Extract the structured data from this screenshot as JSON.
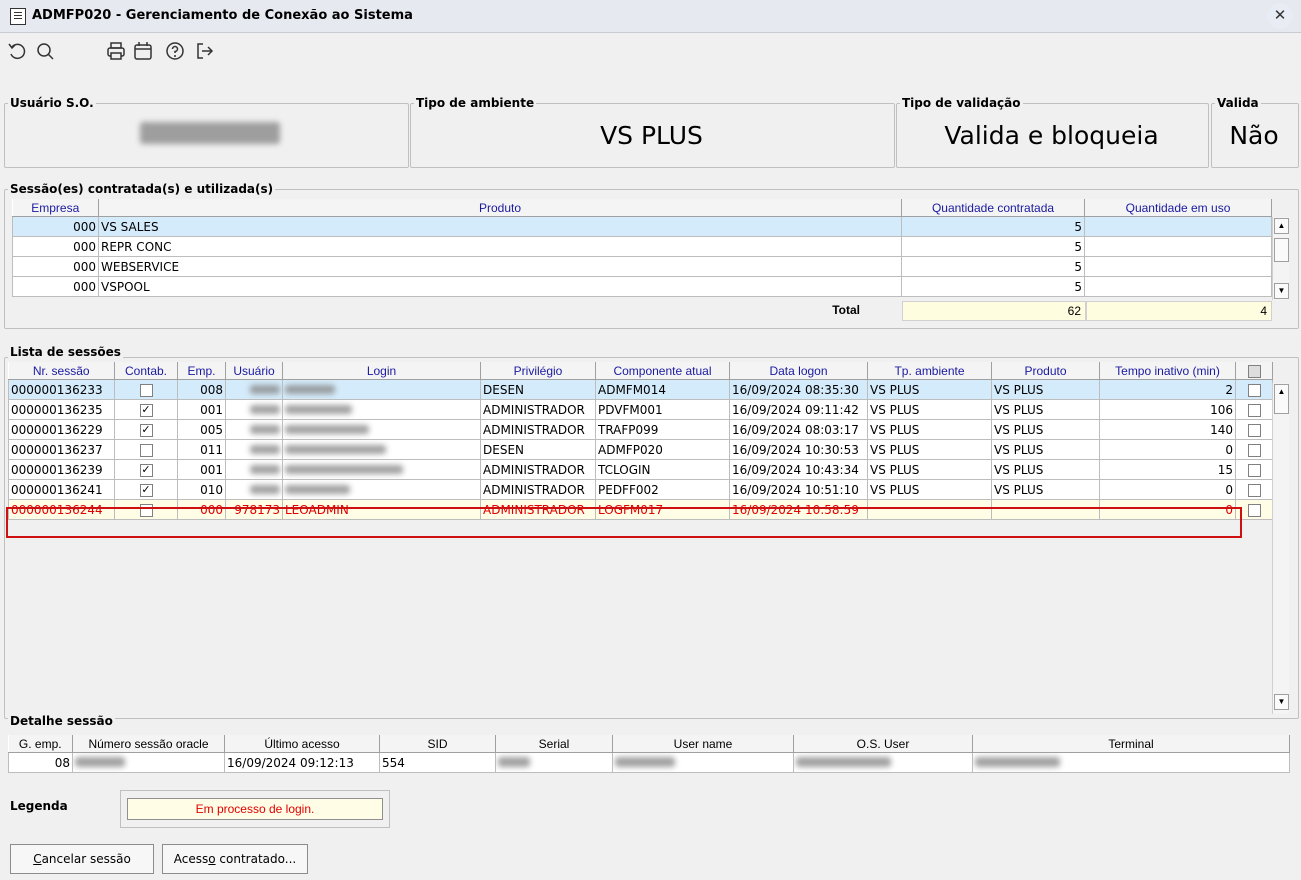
{
  "window": {
    "title": "ADMFP020 - Gerenciamento de Conexão ao Sistema",
    "close_glyph": "✕"
  },
  "toolbar": [
    "refresh-icon",
    "search-icon",
    "print-icon",
    "calendar-icon",
    "help-icon",
    "exit-icon"
  ],
  "info": {
    "usuario_so": {
      "label": "Usuário S.O.",
      "value_blurred": ""
    },
    "tipo_ambiente": {
      "label": "Tipo de ambiente",
      "value": "VS PLUS"
    },
    "tipo_validacao": {
      "label": "Tipo de validação",
      "value": "Valida e bloqueia"
    },
    "valida": {
      "label": "Valida",
      "value": "Não"
    }
  },
  "sessoes_contratadas": {
    "label": "Sessão(es) contratada(s) e utilizada(s)",
    "columns": [
      "Empresa",
      "Produto",
      "Quantidade contratada",
      "Quantidade em uso"
    ],
    "rows": [
      {
        "empresa": "000",
        "produto": "VS SALES",
        "contratada": "5",
        "em_uso": ""
      },
      {
        "empresa": "000",
        "produto": "REPR CONC",
        "contratada": "5",
        "em_uso": ""
      },
      {
        "empresa": "000",
        "produto": "WEBSERVICE",
        "contratada": "5",
        "em_uso": ""
      },
      {
        "empresa": "000",
        "produto": "VSPOOL",
        "contratada": "5",
        "em_uso": ""
      }
    ],
    "total_label": "Total",
    "total_contratada": "62",
    "total_em_uso": "4"
  },
  "lista_sessoes": {
    "label": "Lista de sessões",
    "columns": [
      "Nr. sessão",
      "Contab.",
      "Emp.",
      "Usuário",
      "Login",
      "Privilégio",
      "Componente atual",
      "Data logon",
      "Tp. ambiente",
      "Produto",
      "Tempo inativo (min)"
    ],
    "rows": [
      {
        "nr": "000000136233",
        "contab": "",
        "emp": "008",
        "usuario": "",
        "login": "",
        "privilegio": "DESEN",
        "componente": "ADMFM014",
        "data": "16/09/2024 08:35:30",
        "tp": "VS PLUS",
        "produto": "VS PLUS",
        "tempo": "2"
      },
      {
        "nr": "000000136235",
        "contab": "✓",
        "emp": "001",
        "usuario": "",
        "login": "",
        "privilegio": "ADMINISTRADOR",
        "componente": "PDVFM001",
        "data": "16/09/2024 09:11:42",
        "tp": "VS PLUS",
        "produto": "VS PLUS",
        "tempo": "106"
      },
      {
        "nr": "000000136229",
        "contab": "✓",
        "emp": "005",
        "usuario": "",
        "login": "",
        "privilegio": "ADMINISTRADOR",
        "componente": "TRAFP099",
        "data": "16/09/2024 08:03:17",
        "tp": "VS PLUS",
        "produto": "VS PLUS",
        "tempo": "140"
      },
      {
        "nr": "000000136237",
        "contab": "",
        "emp": "011",
        "usuario": "",
        "login": "",
        "privilegio": "DESEN",
        "componente": "ADMFP020",
        "data": "16/09/2024 10:30:53",
        "tp": "VS PLUS",
        "produto": "VS PLUS",
        "tempo": "0"
      },
      {
        "nr": "000000136239",
        "contab": "✓",
        "emp": "001",
        "usuario": "",
        "login": "",
        "privilegio": "ADMINISTRADOR",
        "componente": "TCLOGIN",
        "data": "16/09/2024 10:43:34",
        "tp": "VS PLUS",
        "produto": "VS PLUS",
        "tempo": "15"
      },
      {
        "nr": "000000136241",
        "contab": "✓",
        "emp": "010",
        "usuario": "",
        "login": "",
        "privilegio": "ADMINISTRADOR",
        "componente": "PEDFF002",
        "data": "16/09/2024 10:51:10",
        "tp": "VS PLUS",
        "produto": "VS PLUS",
        "tempo": "0"
      },
      {
        "nr": "000000136244",
        "contab": "",
        "emp": "000",
        "usuario": "978173",
        "login": "LEOADMIN",
        "privilegio": "ADMINISTRADOR",
        "componente": "LOGFM017",
        "data": "16/09/2024 10:58:59",
        "tp": "",
        "produto": "",
        "tempo": "0"
      }
    ]
  },
  "detalhe": {
    "label": "Detalhe sessão",
    "columns": [
      "G. emp.",
      "Número sessão oracle",
      "Último acesso",
      "SID",
      "Serial",
      "User name",
      "O.S. User",
      "Terminal"
    ],
    "row": {
      "gemp": "08",
      "oracle": "",
      "ultimo": "16/09/2024 09:12:13",
      "sid": "554",
      "serial": "",
      "user": "",
      "osuser": "",
      "terminal": ""
    }
  },
  "legenda": {
    "label": "Legenda",
    "item": "Em processo de login."
  },
  "buttons": {
    "cancelar": {
      "mnemonic": "C",
      "rest": "ancelar sessão"
    },
    "acesso": {
      "before": "Acess",
      "mnemonic": "o",
      "after": " contratado..."
    }
  },
  "colors": {
    "selected_row": "#d4ebfb",
    "login_row_text": "#e00000",
    "login_row_bg": "#fffde6",
    "highlight_border": "#d01010",
    "header_text": "#1a1aa0"
  }
}
